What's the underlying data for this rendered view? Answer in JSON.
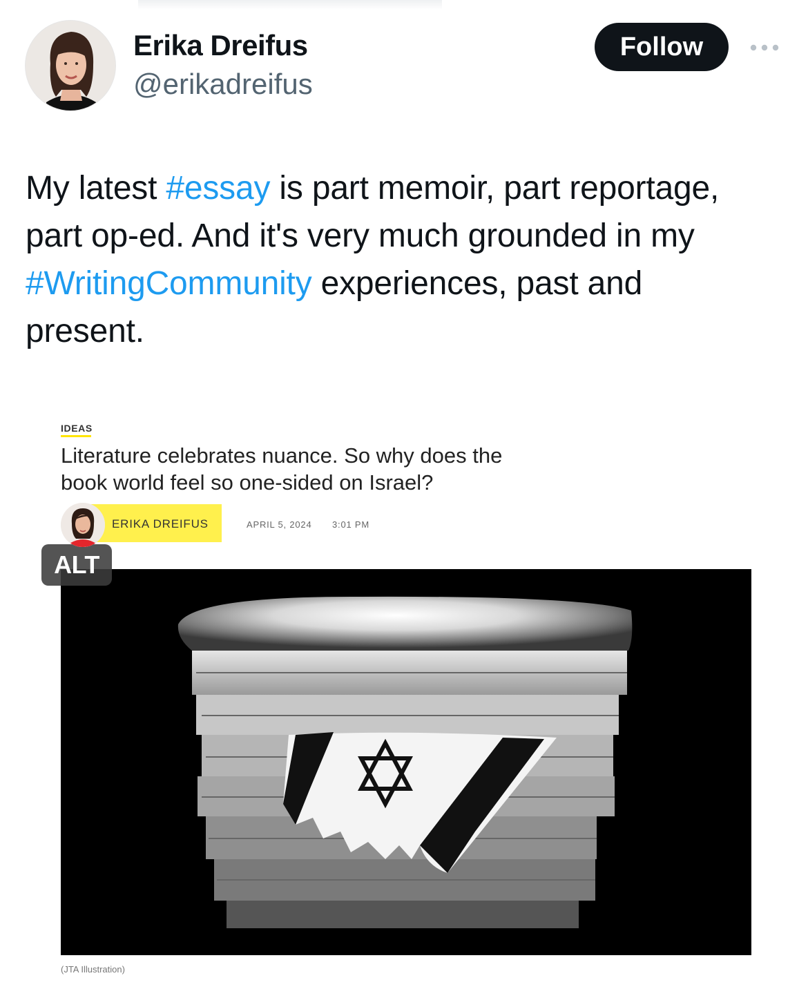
{
  "author": {
    "display_name": "Erika Dreifus",
    "handle": "@erikadreifus"
  },
  "actions": {
    "follow_label": "Follow",
    "more_icon": "more-horizontal-icon"
  },
  "tweet": {
    "lines": [
      [
        {
          "text": "My latest "
        },
        {
          "text": "#essay",
          "tag": true
        },
        {
          "text": " is part memoir, part reportage,"
        }
      ],
      [
        {
          "text": "part op-ed. And it's very much grounded in my"
        }
      ],
      [
        {
          "text": "#WritingCommunity",
          "tag": true
        },
        {
          "text": " experiences, past and"
        }
      ],
      [
        {
          "text": "present."
        }
      ]
    ]
  },
  "article": {
    "kicker": "IDEAS",
    "headline_line1": "Literature celebrates nuance. So why does the",
    "headline_line2": "book world feel so one-sided on Israel?",
    "byline_name": "ERIKA DREIFUS",
    "date": "APRIL 5, 2024",
    "time": "3:01 PM",
    "caption": "(JTA Illustration)"
  },
  "media": {
    "alt_label": "ALT"
  },
  "colors": {
    "link": "#1d9bf0",
    "text": "#0f1419",
    "secondary": "#536471",
    "follow_bg": "#0f1419",
    "byline_highlight": "#fff04d"
  }
}
